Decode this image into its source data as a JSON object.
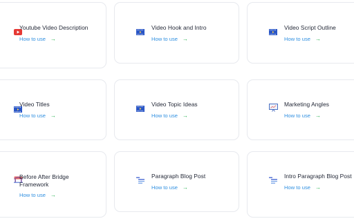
{
  "cards": [
    {
      "title": "Youtube Video Description",
      "link_label": "How to use",
      "icon": "youtube-icon"
    },
    {
      "title": "Video Hook and Intro",
      "link_label": "How to use",
      "icon": "film-icon"
    },
    {
      "title": "Video Script Outline",
      "link_label": "How to use",
      "icon": "film-icon"
    },
    {
      "title": "Video Titles",
      "link_label": "How to use",
      "icon": "film-icon"
    },
    {
      "title": "Video Topic Ideas",
      "link_label": "How to use",
      "icon": "film-icon"
    },
    {
      "title": "Marketing Angles",
      "link_label": "How to use",
      "icon": "presentation-board-icon"
    },
    {
      "title": "Before After Bridge Framework",
      "link_label": "How to use",
      "icon": "bridge-icon"
    },
    {
      "title": "Paragraph Blog Post",
      "link_label": "How to use",
      "icon": "paragraph-lines-icon"
    },
    {
      "title": "Intro Paragraph Blog Post",
      "link_label": "How to use",
      "icon": "paragraph-lines-icon"
    }
  ],
  "arrow_glyph": "→",
  "colors": {
    "title": "#1f2433",
    "link": "#2f8fe0",
    "arrow": "#22b14c",
    "card_border": "#e7e9ee",
    "youtube_red": "#e53935",
    "film_blue": "#2a56c6"
  }
}
